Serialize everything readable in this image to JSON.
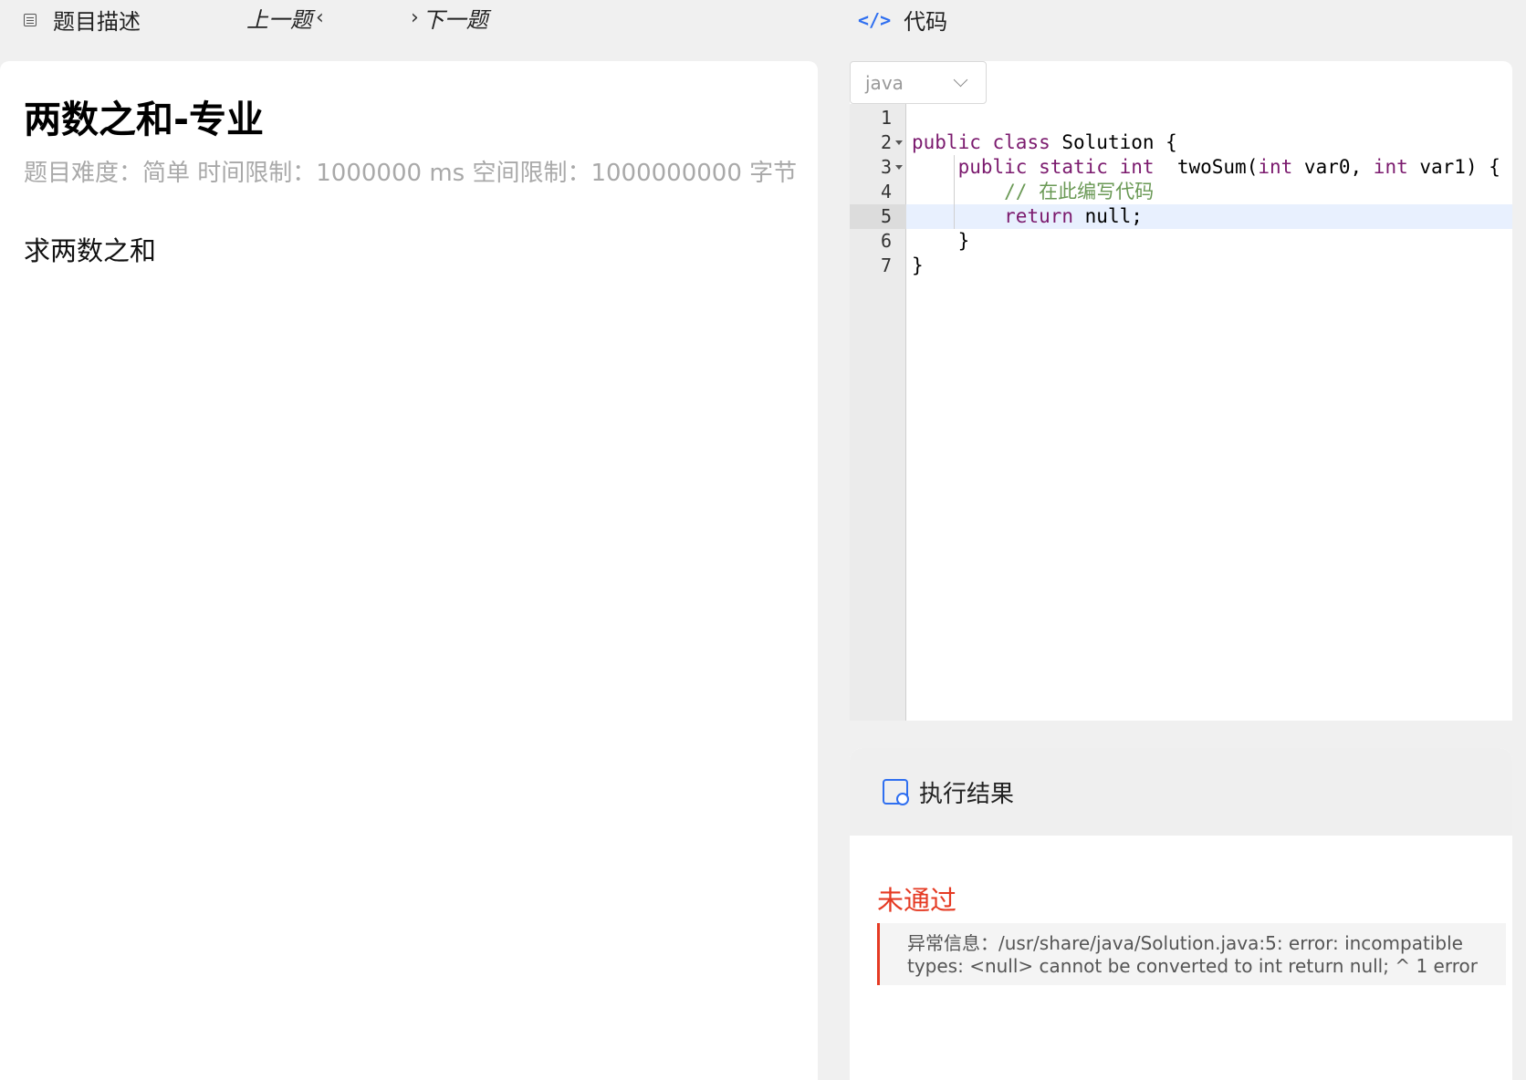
{
  "left_header": {
    "tab_label": "题目描述",
    "prev_label": "上一题",
    "next_label": "下一题"
  },
  "problem": {
    "title": "两数之和-专业",
    "meta": "题目难度：简单 时间限制：1000000 ms 空间限制：1000000000 字节",
    "body": "求两数之和"
  },
  "right_header": {
    "code_icon_text": "</>",
    "tab_label": "代码"
  },
  "editor": {
    "language": "java",
    "line_numbers": [
      "1",
      "2",
      "3",
      "4",
      "5",
      "6",
      "7"
    ],
    "active_line": 5,
    "lines": [
      {
        "n": "1",
        "tokens": []
      },
      {
        "n": "2",
        "tokens": [
          [
            "kw",
            "public"
          ],
          [
            "t",
            " "
          ],
          [
            "kw",
            "class"
          ],
          [
            "t",
            " Solution {"
          ]
        ]
      },
      {
        "n": "3",
        "tokens": [
          [
            "t",
            "    "
          ],
          [
            "kw",
            "public"
          ],
          [
            "t",
            " "
          ],
          [
            "kw",
            "static"
          ],
          [
            "t",
            " "
          ],
          [
            "kw",
            "int"
          ],
          [
            "t",
            "  twoSum("
          ],
          [
            "kw",
            "int"
          ],
          [
            "t",
            " var0, "
          ],
          [
            "kw",
            "int"
          ],
          [
            "t",
            " var1) {"
          ]
        ]
      },
      {
        "n": "4",
        "tokens": [
          [
            "t",
            "        "
          ],
          [
            "cm",
            "// 在此编写代码"
          ]
        ]
      },
      {
        "n": "5",
        "tokens": [
          [
            "t",
            "        "
          ],
          [
            "kw",
            "return"
          ],
          [
            "t",
            " null;"
          ]
        ]
      },
      {
        "n": "6",
        "tokens": [
          [
            "t",
            "    }"
          ]
        ]
      },
      {
        "n": "7",
        "tokens": [
          [
            "t",
            "}"
          ]
        ]
      }
    ]
  },
  "result": {
    "title": "执行结果",
    "status": "未通过",
    "error_message": "异常信息：/usr/share/java/Solution.java:5: error: incompatible types: <null> cannot be converted to int return null; ^ 1 error"
  }
}
